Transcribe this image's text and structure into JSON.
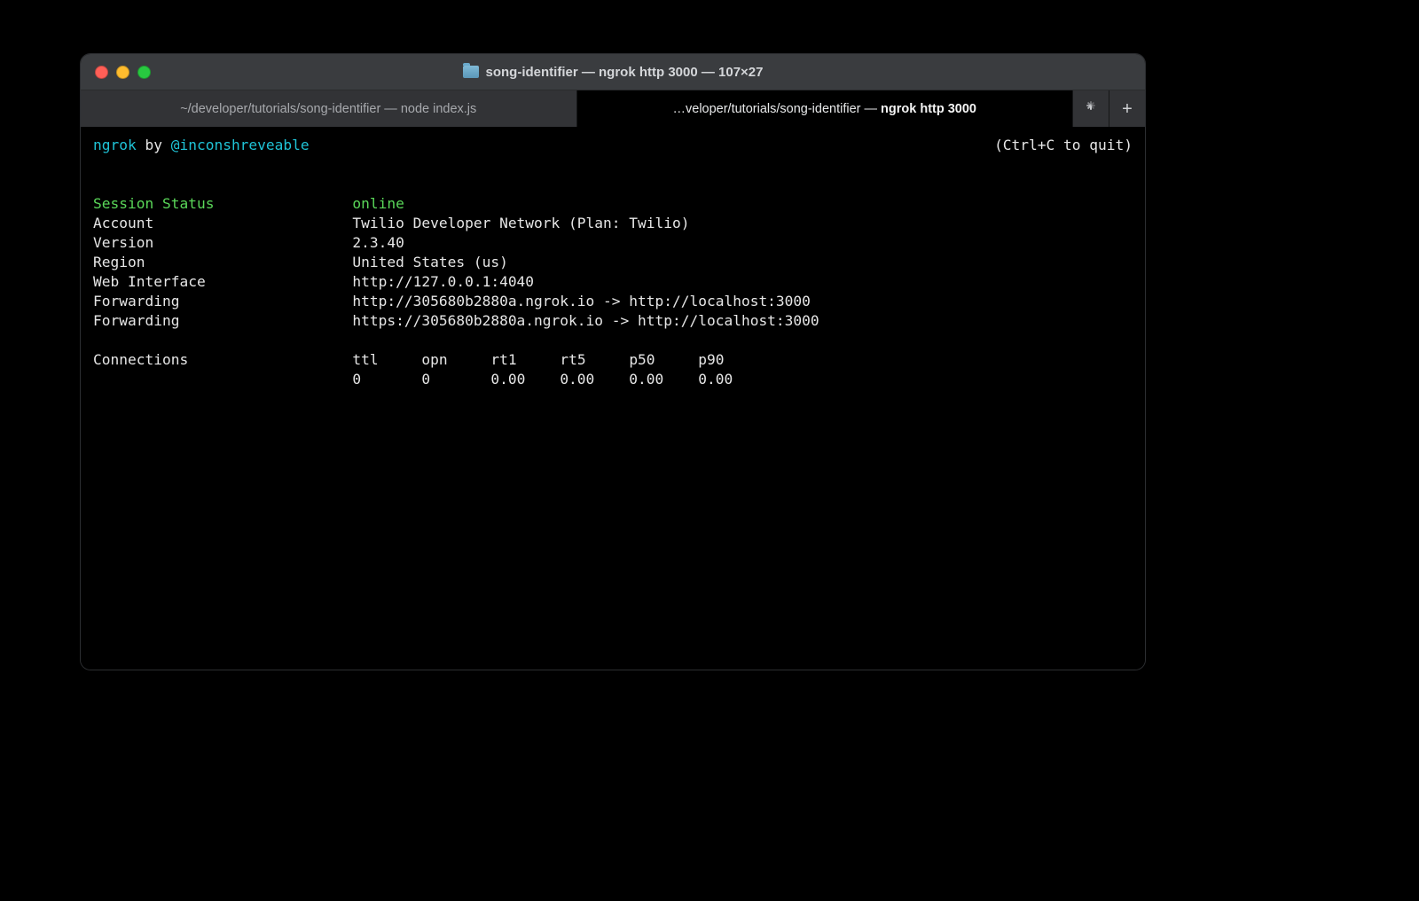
{
  "window": {
    "title": "song-identifier — ngrok http 3000 — 107×27"
  },
  "tabs": [
    {
      "label": "~/developer/tutorials/song-identifier — node index.js",
      "active": false
    },
    {
      "label_prefix": "…veloper/tutorials/song-identifier — ",
      "label_bright": "ngrok http 3000",
      "active": true
    }
  ],
  "header": {
    "app": "ngrok",
    "by": " by ",
    "author": "@inconshreveable",
    "quit_hint": "(Ctrl+C to quit)"
  },
  "fields": {
    "session_status_label": "Session Status",
    "session_status_value": "online",
    "account_label": "Account",
    "account_value": "Twilio Developer Network (Plan: Twilio)",
    "version_label": "Version",
    "version_value": "2.3.40",
    "region_label": "Region",
    "region_value": "United States (us)",
    "web_interface_label": "Web Interface",
    "web_interface_value": "http://127.0.0.1:4040",
    "forwarding1_label": "Forwarding",
    "forwarding1_value": "http://305680b2880a.ngrok.io -> http://localhost:3000",
    "forwarding2_label": "Forwarding",
    "forwarding2_value": "https://305680b2880a.ngrok.io -> http://localhost:3000"
  },
  "connections": {
    "label": "Connections",
    "headers": {
      "ttl": "ttl",
      "opn": "opn",
      "rt1": "rt1",
      "rt5": "rt5",
      "p50": "p50",
      "p90": "p90"
    },
    "values": {
      "ttl": "0",
      "opn": "0",
      "rt1": "0.00",
      "rt5": "0.00",
      "p50": "0.00",
      "p90": "0.00"
    }
  }
}
